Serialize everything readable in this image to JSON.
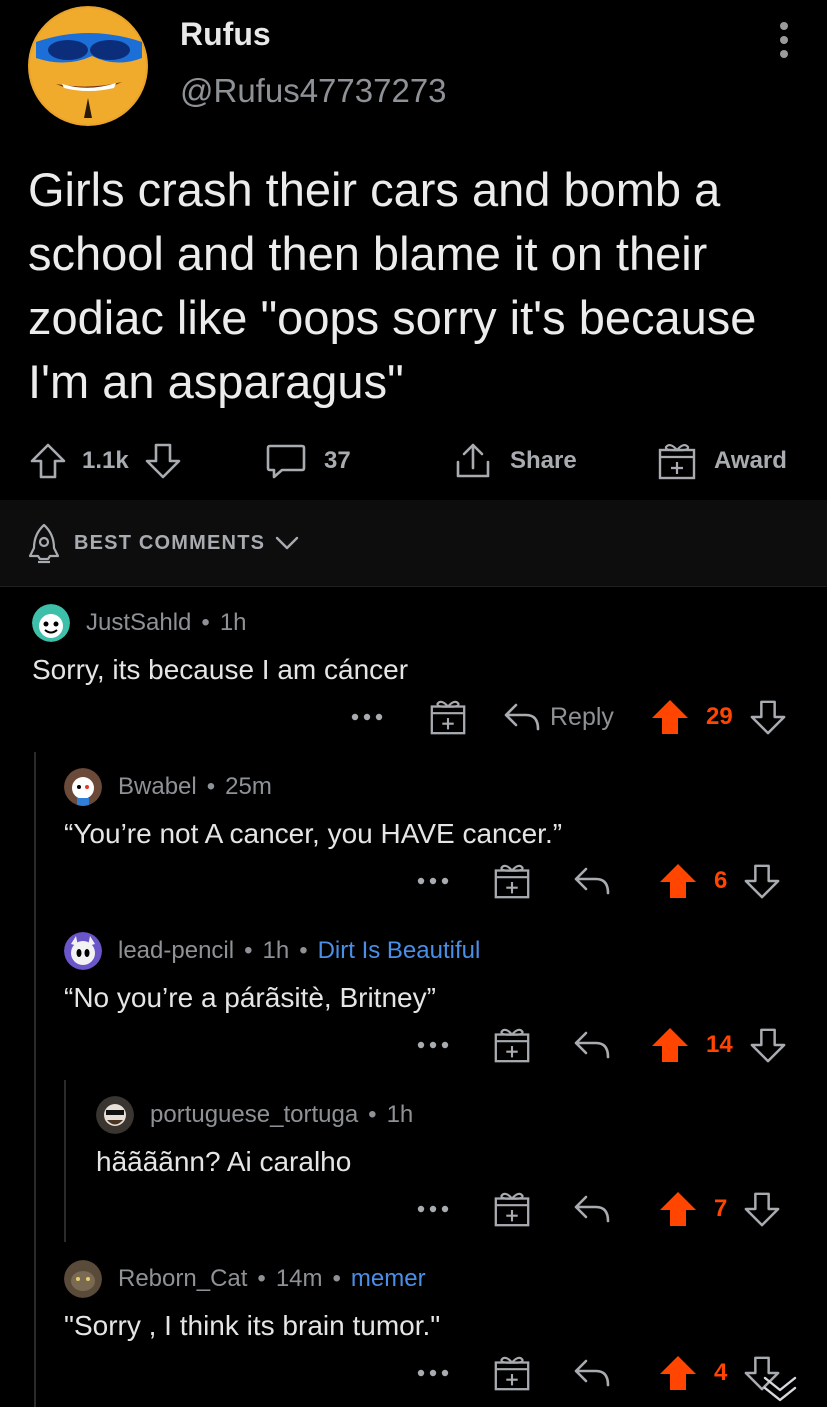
{
  "post": {
    "author_name": "Rufus",
    "author_handle": "@Rufus47737273",
    "text": "Girls crash their cars and bomb a school and then blame it on their zodiac like \"oops sorry it's because I'm an asparagus\""
  },
  "post_actions": {
    "score": "1.1k",
    "comments": "37",
    "share_label": "Share",
    "award_label": "Award"
  },
  "sort": {
    "label": "BEST COMMENTS"
  },
  "comments": [
    {
      "user": "JustSahld",
      "time": "1h",
      "flair": "",
      "text": "Sorry, its because I am cáncer",
      "reply_label": "Reply",
      "score": "29",
      "avatar_color": "#3dbfa9"
    },
    {
      "user": "Bwabel",
      "time": "25m",
      "flair": "",
      "text": "“You’re not A cancer, you HAVE cancer.”",
      "reply_label": "",
      "score": "6",
      "avatar_color": "#6b4a3a"
    },
    {
      "user": "lead-pencil",
      "time": "1h",
      "flair": "Dirt Is Beautiful",
      "text": "“No you’re a párãsitè, Britney”",
      "reply_label": "",
      "score": "14",
      "avatar_color": "#6b56c9"
    },
    {
      "user": "portuguese_tortuga",
      "time": "1h",
      "flair": "",
      "text": "hããããnn? Ai caralho",
      "reply_label": "",
      "score": "7",
      "avatar_color": "#3a3530"
    },
    {
      "user": "Reborn_Cat",
      "time": "14m",
      "flair": "memer",
      "text": "\"Sorry , I think its brain tumor.\"",
      "reply_label": "",
      "score": "4",
      "avatar_color": "#5a4a3a"
    }
  ],
  "colors": {
    "upvote": "#ff4500",
    "flair": "#4a8fe7",
    "background": "#000000"
  },
  "icons": [
    "kebab-menu-icon",
    "upvote-icon",
    "downvote-icon",
    "comment-icon",
    "share-icon",
    "award-icon",
    "rocket-icon",
    "chevron-down-icon",
    "more-icon",
    "reply-icon"
  ]
}
